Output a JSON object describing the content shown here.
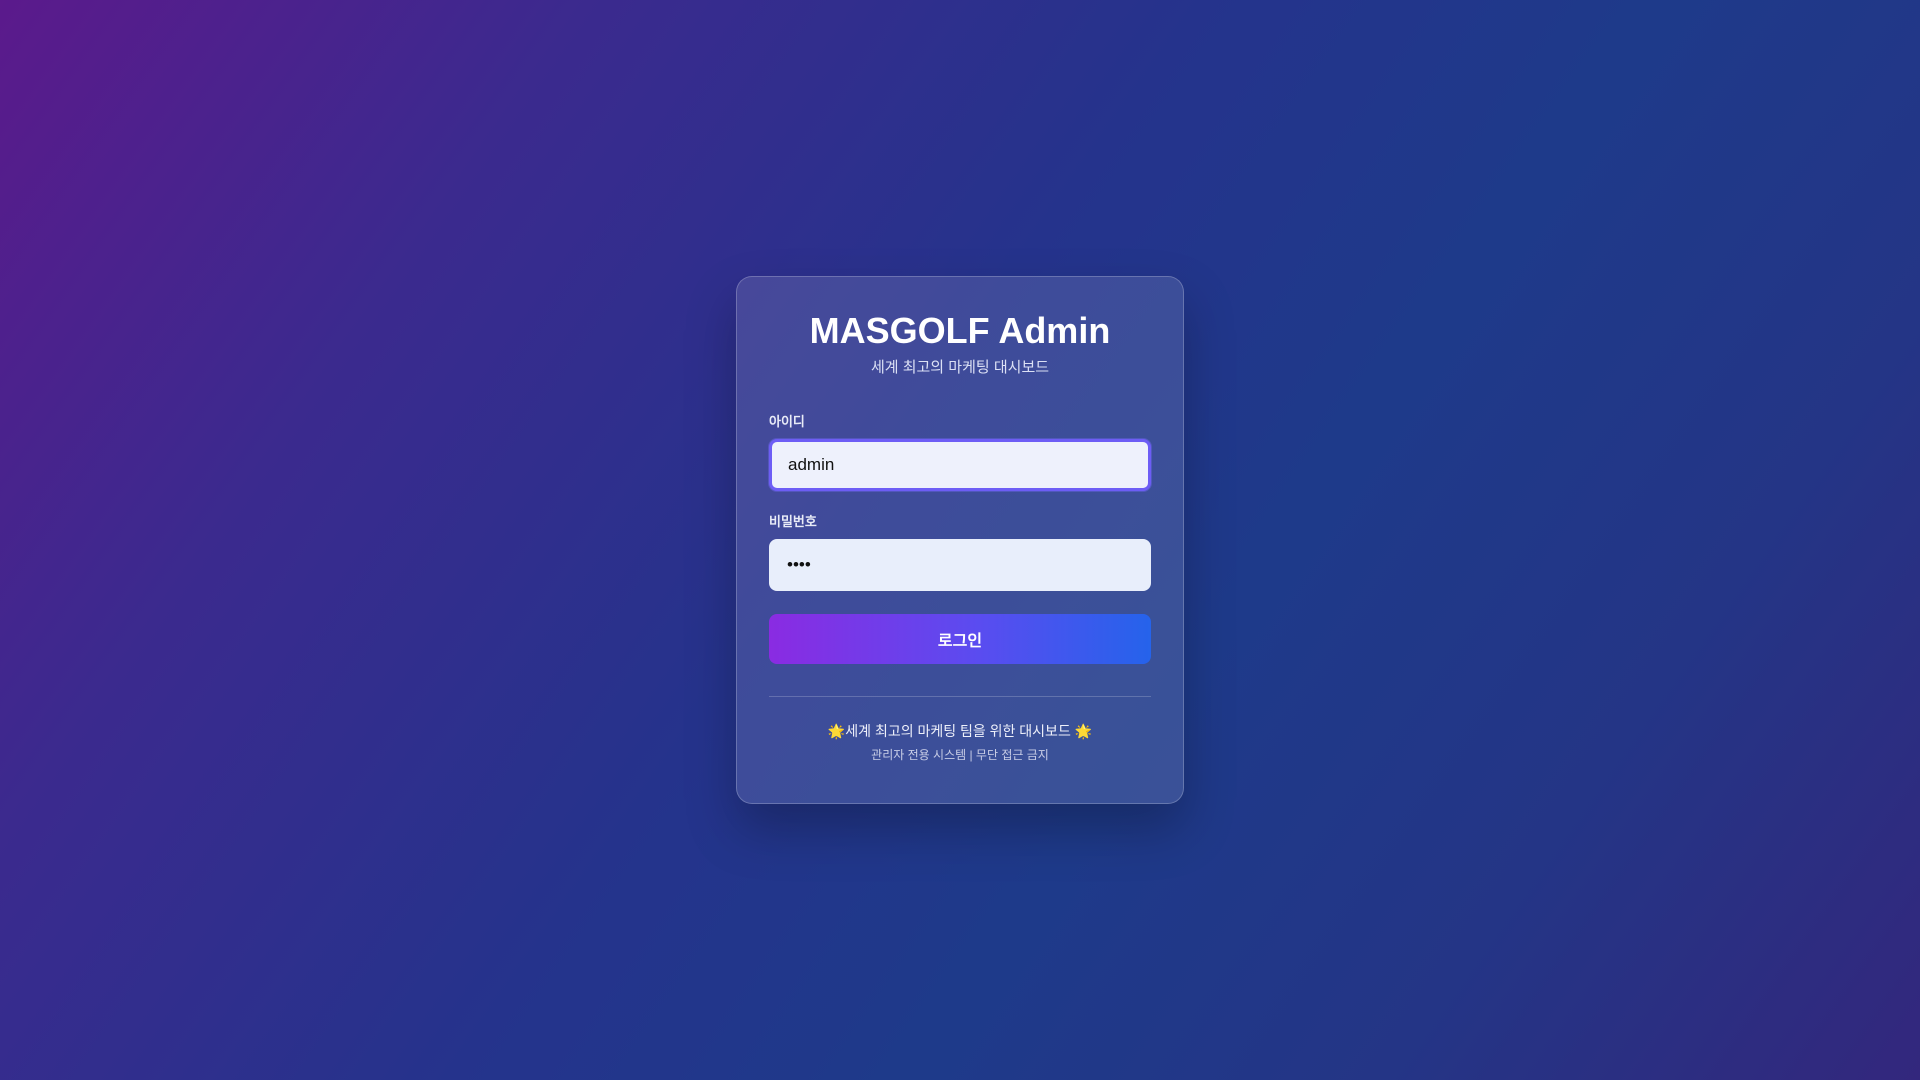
{
  "login": {
    "title": "MASGOLF Admin",
    "subtitle": "세계 최고의 마케팅 대시보드",
    "username": {
      "label": "아이디",
      "value": "admin"
    },
    "password": {
      "label": "비밀번호",
      "value": "••••"
    },
    "button_label": "로그인"
  },
  "footer": {
    "tagline": "🌟세계 최고의 마케팅 팀을 위한 대시보드 🌟",
    "notice": "관리자 전용 시스템 | 무단 접근 금지"
  },
  "colors": {
    "accent": "#6d5df5",
    "button_start": "#8a2be2",
    "button_end": "#2563eb"
  }
}
